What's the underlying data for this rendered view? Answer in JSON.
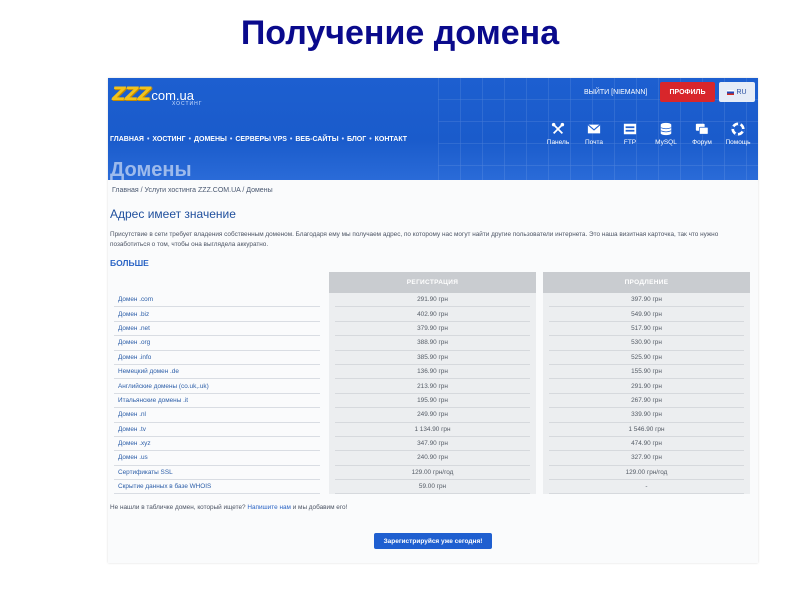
{
  "slide": {
    "title": "Получение домена"
  },
  "header": {
    "logo_main": "ZZZ",
    "logo_domain": "com.ua",
    "logo_sub": "ХОСТИНГ",
    "logout": "ВЫЙТИ [NIEMANN]",
    "profile_button": "ПРОФИЛЬ",
    "lang": "RU",
    "colors": {
      "brand_blue": "#1d5fd0",
      "profile_red": "#d8262b",
      "logo_yellow": "#f3c21b"
    }
  },
  "nav": {
    "items": [
      "ГЛАВНАЯ",
      "ХОСТИНГ",
      "ДОМЕНЫ",
      "СЕРВЕРЫ VPS",
      "ВЕБ-САЙТЫ",
      "БЛОГ",
      "КОНТАКТ"
    ],
    "separator": "•"
  },
  "tools": [
    {
      "label": "Панель",
      "icon": "tools-icon"
    },
    {
      "label": "Почта",
      "icon": "mail-icon"
    },
    {
      "label": "FTP",
      "icon": "ftp-icon"
    },
    {
      "label": "MySQL",
      "icon": "database-icon"
    },
    {
      "label": "Форум",
      "icon": "forum-icon"
    },
    {
      "label": "Помощь",
      "icon": "lifebuoy-icon"
    }
  ],
  "page": {
    "title": "Домены",
    "breadcrumb": [
      "Главная",
      "Услуги хостинга ZZZ.COM.UA",
      "Домены"
    ],
    "breadcrumb_separator": "/",
    "heading": "Адрес имеет значение",
    "intro": "Присутствие в сети требует владения собственным доменом. Благодаря ему мы получаем адрес, по которому нас могут найти другие пользователи интернета. Это наша визитная карточка, так что нужно позаботиться о том, чтобы она выглядела аккуратно.",
    "more": "БОЛЬШЕ"
  },
  "table": {
    "col_registration": "РЕГИСТРАЦИЯ",
    "col_renewal": "ПРОДЛЕНИЕ",
    "rows": [
      {
        "name": "Домен .com",
        "registration": "291.90 грн",
        "renewal": "397.90 грн"
      },
      {
        "name": "Домен .biz",
        "registration": "402.90 грн",
        "renewal": "549.90 грн"
      },
      {
        "name": "Домен .net",
        "registration": "379.90 грн",
        "renewal": "517.90 грн"
      },
      {
        "name": "Домен .org",
        "registration": "388.90 грн",
        "renewal": "530.90 грн"
      },
      {
        "name": "Домен .info",
        "registration": "385.90 грн",
        "renewal": "525.90 грн"
      },
      {
        "name": "Немецкий домен .de",
        "registration": "136.90 грн",
        "renewal": "155.90 грн"
      },
      {
        "name": "Английские домены (co.uk,.uk)",
        "registration": "213.90 грн",
        "renewal": "291.90 грн"
      },
      {
        "name": "Итальянские домены .it",
        "registration": "195.90 грн",
        "renewal": "267.90 грн"
      },
      {
        "name": "Домен .nl",
        "registration": "249.90 грн",
        "renewal": "339.90 грн"
      },
      {
        "name": "Домен .tv",
        "registration": "1 134.90 грн",
        "renewal": "1 546.90 грн"
      },
      {
        "name": "Домен .xyz",
        "registration": "347.90 грн",
        "renewal": "474.90 грн"
      },
      {
        "name": "Домен .us",
        "registration": "240.90 грн",
        "renewal": "327.90 грн"
      },
      {
        "name": "Сертификаты SSL",
        "registration": "129.00 грн/год",
        "renewal": "129.00 грн/год"
      },
      {
        "name": "Скрытие данных в базе WHOIS",
        "registration": "59.00 грн",
        "renewal": "-"
      }
    ]
  },
  "footer": {
    "notfound_text": "Не нашли в табличке домен, который ищете?",
    "notfound_link": "Напишите нам",
    "notfound_tail": "и мы добавим его!",
    "cta": "Зарегистрируйся уже сегодня!"
  }
}
